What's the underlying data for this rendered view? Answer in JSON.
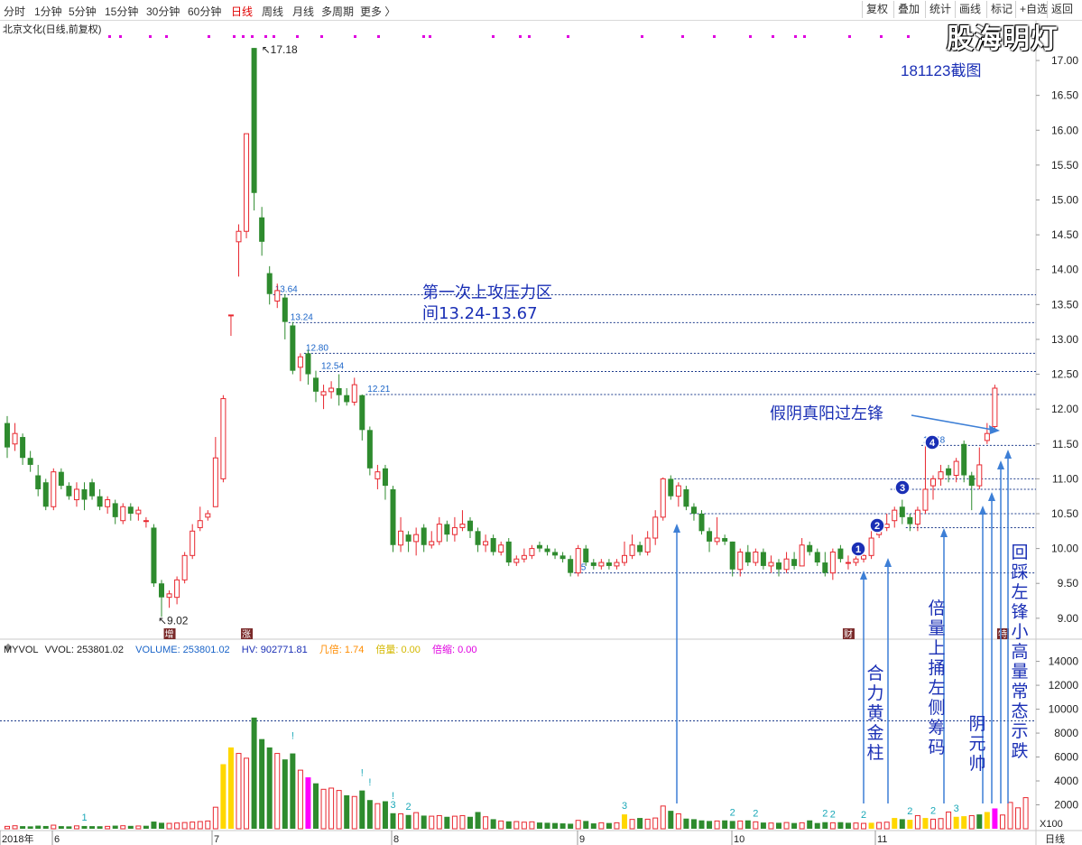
{
  "toolbar": {
    "periods": [
      {
        "label": "分时",
        "active": false
      },
      {
        "label": "1分钟",
        "active": false
      },
      {
        "label": "5分钟",
        "active": false
      },
      {
        "label": "15分钟",
        "active": false
      },
      {
        "label": "30分钟",
        "active": false
      },
      {
        "label": "60分钟",
        "active": false
      },
      {
        "label": "日线",
        "active": true
      },
      {
        "label": "周线",
        "active": false
      },
      {
        "label": "月线",
        "active": false
      },
      {
        "label": "多周期",
        "active": false
      },
      {
        "label": "更多 〉",
        "active": false
      }
    ],
    "right_buttons": [
      "复权",
      "叠加",
      "统计",
      "画线",
      "标记",
      "+自选",
      "返回"
    ]
  },
  "stock_title": "北京文化(日线,前复权)",
  "watermark": "股海明灯",
  "capture_date": "181123截图",
  "colors": {
    "up": "#e8272f",
    "down": "#2e8b2e",
    "grid": "#1e3c8c",
    "annotation": "#1a2fb5",
    "arrow": "#3d7fd6"
  },
  "chart_data": {
    "type": "candlestick",
    "period": "日线",
    "ylim": [
      8.7,
      17.35
    ],
    "y_ticks": [
      "17.00",
      "16.50",
      "16.00",
      "15.50",
      "15.00",
      "14.50",
      "14.00",
      "13.50",
      "13.00",
      "12.50",
      "12.00",
      "11.50",
      "11.00",
      "10.50",
      "10.00",
      "9.50",
      "9.00"
    ],
    "x_labels": [
      "2018年",
      "6",
      "7",
      "8",
      "9",
      "10",
      "11"
    ],
    "x_axis_right_label": "日线",
    "high_marker": "17.18",
    "low_marker": "9.02",
    "candles": [
      [
        11.8,
        11.45,
        11.9,
        11.3
      ],
      [
        11.5,
        11.65,
        11.8,
        11.4
      ],
      [
        11.6,
        11.3,
        11.65,
        11.2
      ],
      [
        11.3,
        11.2,
        11.4,
        11.1
      ],
      [
        11.05,
        10.85,
        11.2,
        10.75
      ],
      [
        10.95,
        10.6,
        11.0,
        10.55
      ],
      [
        10.6,
        11.1,
        11.15,
        10.55
      ],
      [
        11.1,
        10.9,
        11.15,
        10.85
      ],
      [
        10.9,
        10.75,
        10.95,
        10.7
      ],
      [
        10.7,
        10.85,
        10.95,
        10.6
      ],
      [
        10.85,
        10.7,
        10.95,
        10.55
      ],
      [
        10.95,
        10.75,
        11.0,
        10.7
      ],
      [
        10.75,
        10.6,
        10.85,
        10.55
      ],
      [
        10.6,
        10.7,
        10.75,
        10.5
      ],
      [
        10.65,
        10.45,
        10.7,
        10.35
      ],
      [
        10.4,
        10.6,
        10.65,
        10.35
      ],
      [
        10.6,
        10.5,
        10.65,
        10.4
      ],
      [
        10.5,
        10.55,
        10.6,
        10.4
      ],
      [
        10.4,
        10.4,
        10.45,
        10.3
      ],
      [
        10.3,
        9.5,
        10.35,
        9.45
      ],
      [
        9.5,
        9.3,
        9.55,
        9.02
      ],
      [
        9.3,
        9.35,
        9.4,
        9.15
      ],
      [
        9.3,
        9.55,
        9.6,
        9.2
      ],
      [
        9.55,
        9.9,
        9.95,
        9.5
      ],
      [
        9.9,
        10.25,
        10.35,
        9.85
      ],
      [
        10.3,
        10.4,
        10.6,
        10.25
      ],
      [
        10.45,
        10.5,
        10.55,
        10.4
      ],
      [
        10.6,
        11.3,
        11.6,
        10.6
      ],
      [
        11.0,
        12.15,
        12.2,
        10.95
      ],
      [
        13.35,
        13.35,
        13.35,
        13.05
      ],
      [
        14.4,
        14.55,
        14.65,
        13.9
      ],
      [
        14.55,
        15.95,
        15.95,
        14.45
      ],
      [
        17.18,
        15.1,
        17.18,
        14.85
      ],
      [
        14.75,
        14.4,
        14.9,
        14.2
      ],
      [
        13.95,
        13.65,
        14.05,
        13.5
      ],
      [
        13.55,
        13.7,
        13.8,
        13.45
      ],
      [
        13.6,
        13.25,
        13.65,
        13.0
      ],
      [
        13.2,
        12.55,
        13.25,
        12.5
      ],
      [
        12.6,
        12.75,
        12.8,
        12.4
      ],
      [
        12.8,
        12.5,
        12.85,
        12.35
      ],
      [
        12.45,
        12.25,
        12.55,
        12.1
      ],
      [
        12.2,
        12.25,
        12.35,
        12.0
      ],
      [
        12.25,
        12.3,
        12.4,
        12.15
      ],
      [
        12.3,
        12.2,
        12.5,
        12.05
      ],
      [
        12.2,
        12.1,
        12.3,
        12.05
      ],
      [
        12.1,
        12.35,
        12.45,
        12.05
      ],
      [
        12.2,
        11.7,
        12.21,
        11.55
      ],
      [
        11.7,
        11.15,
        11.75,
        11.05
      ],
      [
        11.0,
        11.1,
        11.2,
        10.85
      ],
      [
        11.15,
        10.9,
        11.2,
        10.7
      ],
      [
        10.85,
        10.05,
        10.9,
        9.95
      ],
      [
        10.05,
        10.25,
        10.45,
        9.95
      ],
      [
        10.2,
        10.1,
        10.25,
        9.95
      ],
      [
        10.1,
        10.2,
        10.3,
        9.9
      ],
      [
        10.3,
        10.05,
        10.35,
        9.95
      ],
      [
        10.05,
        10.1,
        10.25,
        10.0
      ],
      [
        10.1,
        10.35,
        10.45,
        10.05
      ],
      [
        10.35,
        10.2,
        10.4,
        10.1
      ],
      [
        10.2,
        10.3,
        10.45,
        10.1
      ],
      [
        10.3,
        10.35,
        10.55,
        10.25
      ],
      [
        10.4,
        10.25,
        10.45,
        10.15
      ],
      [
        10.25,
        10.05,
        10.3,
        9.95
      ],
      [
        10.05,
        10.1,
        10.2,
        9.95
      ],
      [
        10.15,
        9.95,
        10.2,
        9.9
      ],
      [
        9.95,
        10.05,
        10.1,
        9.9
      ],
      [
        10.1,
        9.8,
        10.15,
        9.75
      ],
      [
        9.8,
        9.85,
        9.9,
        9.75
      ],
      [
        9.85,
        9.9,
        10.0,
        9.8
      ],
      [
        9.9,
        10.0,
        10.05,
        9.85
      ],
      [
        10.05,
        10.0,
        10.1,
        9.95
      ],
      [
        10.0,
        9.95,
        10.05,
        9.9
      ],
      [
        9.95,
        9.9,
        10.0,
        9.85
      ],
      [
        9.9,
        9.85,
        9.95,
        9.8
      ],
      [
        9.85,
        9.65,
        9.9,
        9.6
      ],
      [
        9.65,
        10.0,
        10.05,
        9.6
      ],
      [
        10.0,
        9.8,
        10.05,
        9.75
      ],
      [
        9.8,
        9.75,
        9.85,
        9.7
      ],
      [
        9.75,
        9.8,
        9.85,
        9.7
      ],
      [
        9.8,
        9.75,
        9.85,
        9.7
      ],
      [
        9.75,
        9.8,
        9.85,
        9.7
      ],
      [
        9.8,
        9.9,
        10.1,
        9.75
      ],
      [
        9.9,
        10.05,
        10.2,
        9.85
      ],
      [
        10.05,
        9.95,
        10.1,
        9.9
      ],
      [
        9.95,
        10.15,
        10.25,
        9.9
      ],
      [
        10.15,
        10.45,
        10.55,
        10.05
      ],
      [
        10.45,
        11.0,
        11.02,
        10.4
      ],
      [
        11.0,
        10.75,
        11.05,
        10.7
      ],
      [
        10.75,
        10.9,
        10.95,
        10.6
      ],
      [
        10.85,
        10.6,
        10.9,
        10.55
      ],
      [
        10.6,
        10.5,
        10.65,
        10.4
      ],
      [
        10.5,
        10.25,
        10.55,
        10.2
      ],
      [
        10.25,
        10.1,
        10.3,
        9.95
      ],
      [
        10.1,
        10.15,
        10.45,
        10.05
      ],
      [
        10.15,
        10.1,
        10.2,
        10.05
      ],
      [
        10.1,
        9.7,
        10.1,
        9.6
      ],
      [
        9.7,
        9.95,
        10.0,
        9.6
      ],
      [
        9.95,
        9.8,
        10.05,
        9.75
      ],
      [
        9.8,
        9.95,
        10.0,
        9.75
      ],
      [
        9.95,
        9.75,
        10.0,
        9.7
      ],
      [
        9.75,
        9.8,
        9.9,
        9.65
      ],
      [
        9.8,
        9.7,
        9.85,
        9.6
      ],
      [
        9.7,
        9.85,
        9.95,
        9.65
      ],
      [
        9.85,
        9.75,
        9.95,
        9.7
      ],
      [
        9.75,
        10.05,
        10.15,
        9.75
      ],
      [
        10.05,
        9.95,
        10.1,
        9.9
      ],
      [
        9.95,
        9.8,
        10.0,
        9.75
      ],
      [
        9.8,
        9.65,
        9.95,
        9.6
      ],
      [
        9.65,
        9.95,
        10.0,
        9.55
      ],
      [
        10.0,
        9.85,
        10.05,
        9.8
      ],
      [
        9.8,
        9.8,
        9.9,
        9.7
      ],
      [
        9.8,
        9.85,
        9.9,
        9.75
      ],
      [
        9.85,
        9.9,
        9.95,
        9.8
      ],
      [
        9.9,
        10.15,
        10.25,
        9.85
      ],
      [
        10.2,
        10.3,
        10.35,
        10.15
      ],
      [
        10.3,
        10.35,
        10.5,
        10.25
      ],
      [
        10.4,
        10.55,
        10.6,
        10.3
      ],
      [
        10.6,
        10.45,
        10.7,
        10.35
      ],
      [
        10.45,
        10.35,
        10.5,
        10.25
      ],
      [
        10.35,
        10.55,
        10.6,
        10.25
      ],
      [
        10.55,
        10.85,
        11.48,
        10.5
      ],
      [
        10.9,
        11.0,
        11.05,
        10.7
      ],
      [
        11.0,
        11.1,
        11.2,
        10.9
      ],
      [
        11.15,
        11.05,
        11.2,
        10.95
      ],
      [
        11.05,
        11.25,
        11.3,
        10.95
      ],
      [
        11.5,
        11.05,
        11.55,
        10.95
      ],
      [
        11.05,
        10.9,
        11.1,
        10.55
      ],
      [
        10.9,
        11.2,
        11.45,
        10.85
      ],
      [
        11.55,
        11.65,
        11.8,
        11.5
      ],
      [
        11.75,
        12.3,
        12.35,
        11.7
      ]
    ],
    "price_lines": [
      {
        "value": 13.64,
        "label": "13.64"
      },
      {
        "value": 13.24,
        "label": "13.24"
      },
      {
        "value": 12.8,
        "label": "12.80"
      },
      {
        "value": 12.54,
        "label": "12.54"
      },
      {
        "value": 12.21,
        "label": "12.21"
      },
      {
        "value": 11.48,
        "label": "11.48"
      },
      {
        "value": 10.85,
        "label": ""
      },
      {
        "value": 10.5,
        "label": ""
      },
      {
        "value": 11.0,
        "label": ""
      },
      {
        "value": 10.3,
        "label": ""
      },
      {
        "value": 9.65,
        "label": "65"
      }
    ],
    "event_marks": [
      {
        "label": "增",
        "index": 21
      },
      {
        "label": "涨",
        "index": 31
      },
      {
        "label": "财",
        "index": 109
      },
      {
        "label": "特",
        "index": 129
      }
    ],
    "annotations": {
      "pressure_zone_line1": "第一次上攻压力区",
      "pressure_zone_line2": "间13.24-13.67",
      "fake_yin": "假阴真阳过左锋",
      "marker_labels": [
        "1",
        "2",
        "3",
        "4"
      ],
      "vertical_notes": [
        "合力黄金柱",
        "倍量上捅左侧筹码",
        "阴元帅",
        "回踩左锋小高量常态示跌"
      ]
    },
    "volume": {
      "legend": {
        "indicator": "MYVOL",
        "vvol": "VVOL: 253801.02",
        "volume": "VOLUME: 253801.02",
        "hv": "HV: 902771.81",
        "ratio": "几倍: 1.74",
        "double": "倍量: 0.00",
        "multiple": "倍缩: 0.00"
      },
      "ylim": [
        0,
        14800
      ],
      "y_ticks": [
        "14000",
        "12000",
        "10000",
        "8000",
        "6000",
        "4000",
        "2000"
      ],
      "unit": "X100",
      "hv_line": 9027.7,
      "values": [
        200,
        250,
        220,
        200,
        260,
        230,
        300,
        220,
        200,
        240,
        230,
        220,
        210,
        200,
        260,
        250,
        240,
        230,
        250,
        600,
        500,
        450,
        480,
        520,
        560,
        600,
        650,
        1800,
        5400,
        6800,
        6300,
        5900,
        9300,
        7500,
        6800,
        6300,
        5800,
        6300,
        4900,
        4300,
        3800,
        3300,
        3400,
        3200,
        2800,
        2700,
        3200,
        2400,
        2100,
        2300,
        1300,
        1250,
        1150,
        1350,
        1100,
        1050,
        1100,
        1000,
        1050,
        1100,
        1000,
        1400,
        1000,
        800,
        650,
        620,
        600,
        550,
        580,
        520,
        500,
        480,
        450,
        420,
        700,
        650,
        450,
        500,
        480,
        500,
        1200,
        780,
        900,
        800,
        900,
        1900,
        1500,
        1250,
        850,
        800,
        700,
        650,
        650,
        700,
        650,
        650,
        700,
        580,
        520,
        480,
        500,
        520,
        480,
        500,
        700,
        480,
        550,
        500,
        550,
        500,
        480,
        450,
        500,
        520,
        550,
        900,
        800,
        750,
        1100,
        900,
        800,
        850,
        1400,
        1000,
        1050,
        1100,
        1200,
        1400,
        1700,
        1150,
        2200,
        1750,
        2600
      ],
      "colors": [
        "u",
        "u",
        "d",
        "d",
        "d",
        "d",
        "u",
        "d",
        "d",
        "u",
        "d",
        "d",
        "d",
        "u",
        "d",
        "u",
        "d",
        "u",
        "d",
        "d",
        "d",
        "u",
        "u",
        "u",
        "u",
        "u",
        "u",
        "u",
        "y",
        "y",
        "u",
        "u",
        "d",
        "d",
        "d",
        "u",
        "d",
        "d",
        "u",
        "m",
        "d",
        "u",
        "u",
        "u",
        "d",
        "u",
        "d",
        "d",
        "u",
        "d",
        "d",
        "u",
        "d",
        "u",
        "d",
        "u",
        "u",
        "d",
        "u",
        "u",
        "d",
        "d",
        "u",
        "d",
        "u",
        "d",
        "u",
        "u",
        "u",
        "d",
        "d",
        "d",
        "d",
        "d",
        "u",
        "d",
        "d",
        "u",
        "d",
        "u",
        "y",
        "u",
        "d",
        "u",
        "u",
        "u",
        "d",
        "u",
        "d",
        "d",
        "d",
        "d",
        "u",
        "d",
        "d",
        "u",
        "d",
        "u",
        "d",
        "u",
        "d",
        "u",
        "d",
        "u",
        "d",
        "d",
        "d",
        "u",
        "d",
        "d",
        "u",
        "u",
        "y",
        "u",
        "u",
        "y",
        "d",
        "y",
        "u",
        "y",
        "u",
        "u",
        "u",
        "y",
        "y",
        "u",
        "d",
        "y",
        "m",
        "u"
      ],
      "count_labels": [
        {
          "index": 10,
          "text": "1"
        },
        {
          "index": 50,
          "text": "3"
        },
        {
          "index": 52,
          "text": "2"
        },
        {
          "index": 80,
          "text": "3"
        },
        {
          "index": 94,
          "text": "2"
        },
        {
          "index": 97,
          "text": "2"
        },
        {
          "index": 106,
          "text": "2"
        },
        {
          "index": 107,
          "text": "2"
        },
        {
          "index": 111,
          "text": "2"
        },
        {
          "index": 117,
          "text": "2"
        },
        {
          "index": 120,
          "text": "2"
        },
        {
          "index": 123,
          "text": "3"
        }
      ],
      "bang_labels": [
        {
          "index": 37,
          "text": "!"
        },
        {
          "index": 46,
          "text": "!"
        },
        {
          "index": 47,
          "text": "!"
        },
        {
          "index": 50,
          "text": "!"
        }
      ]
    }
  }
}
